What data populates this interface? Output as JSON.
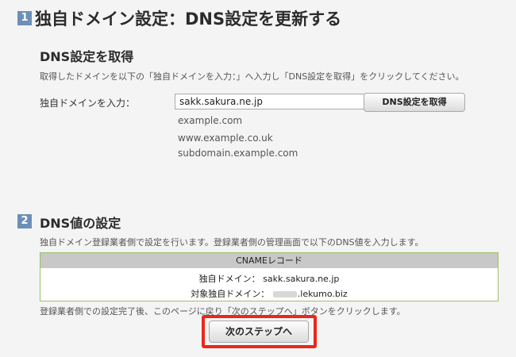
{
  "section1": {
    "number": "1",
    "title": "独自ドメイン設定：DNS設定を更新する",
    "subtitle": "DNS設定を取得",
    "description": "取得したドメインを以下の「独自ドメインを入力：」へ入力し「DNS設定を取得」をクリックしてください。",
    "input_label": "独自ドメインを入力：",
    "input_value": "sakk.sakura.ne.jp",
    "fetch_button": "DNS設定を取得",
    "examples": [
      "example.com",
      "www.example.co.uk",
      "subdomain.example.com"
    ]
  },
  "section2": {
    "number": "2",
    "title": "DNS値の設定",
    "description": "独自ドメイン登録業者側で設定を行います。登録業者側の管理画面で以下のDNS値を入力します。",
    "record": {
      "header": "CNAMEレコード",
      "domain_label": "独自ドメイン：",
      "domain_value": "sakk.sakura.ne.jp",
      "target_label": "対象独自ドメイン：",
      "target_value": ".lekumo.biz"
    },
    "after_text": "登録業者側での設定完了後、このページに戻り「次のステップへ」ボタンをクリックします。",
    "next_button": "次のステップへ"
  },
  "colors": {
    "step_badge": "#6c8fb8",
    "record_border": "#9cc06a",
    "highlight": "#e8281c"
  }
}
